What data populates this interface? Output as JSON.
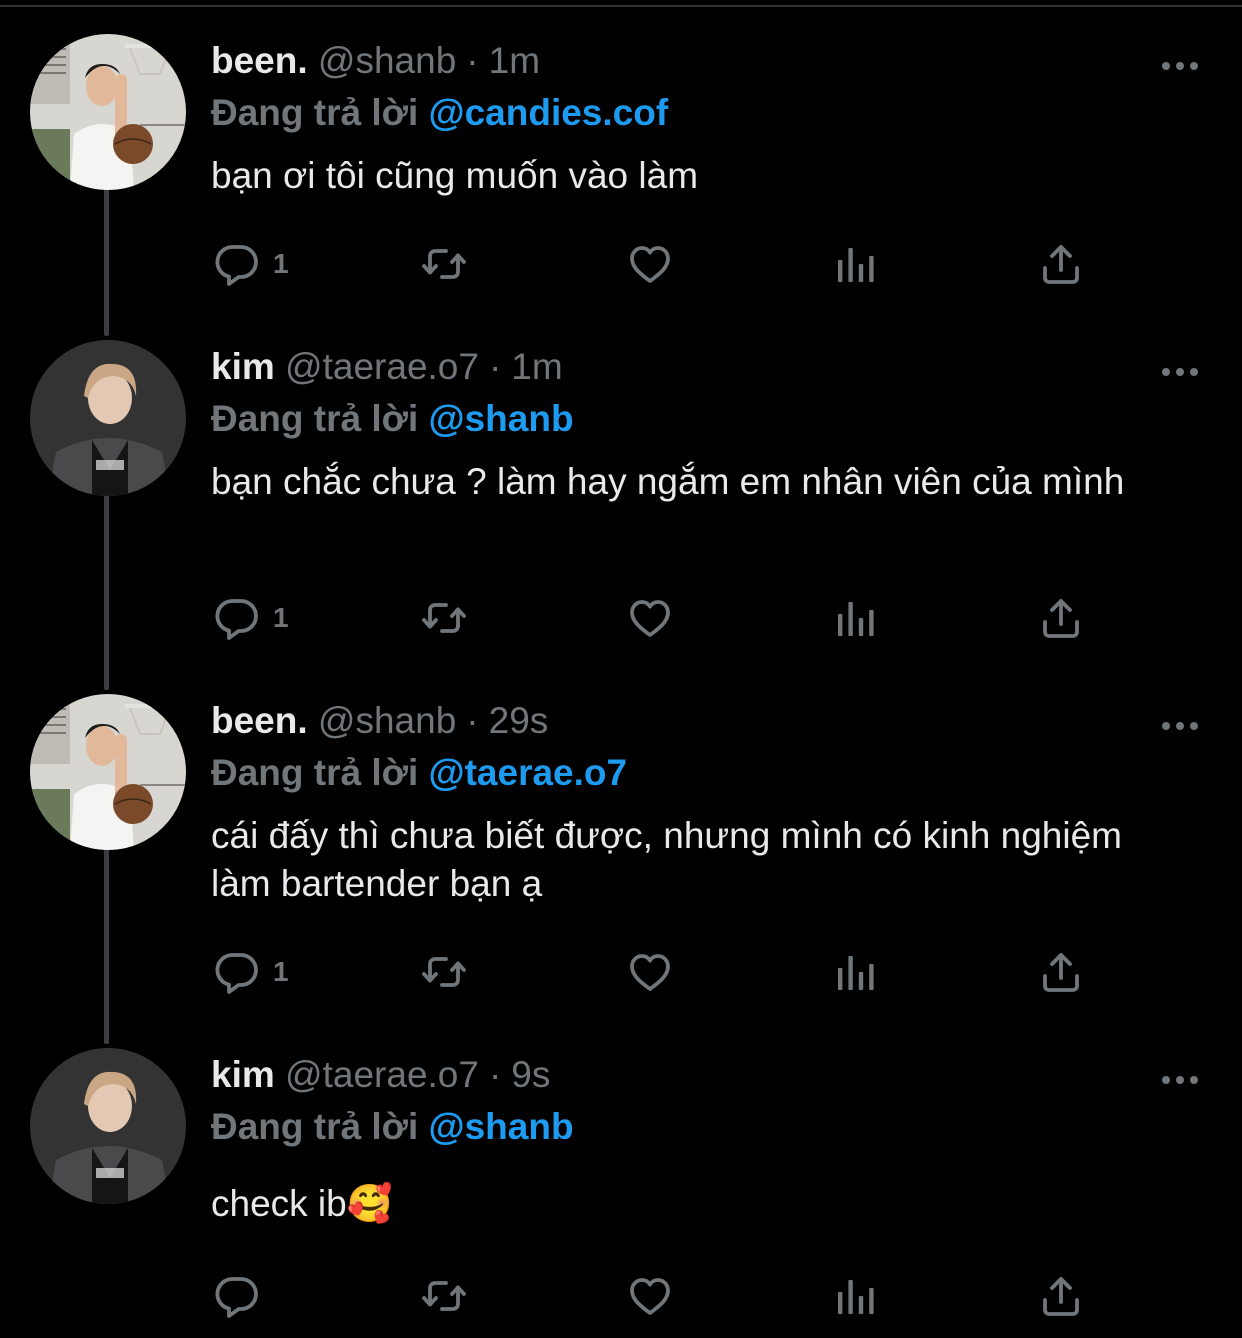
{
  "colors": {
    "background": "#000000",
    "text": "#e7e9ea",
    "muted": "#71767b",
    "mention": "#1d9bf0",
    "thread_line": "#3a3e42"
  },
  "icons": {
    "reply": "reply-icon",
    "retweet": "retweet-icon",
    "like": "heart-icon",
    "views": "analytics-icon",
    "share": "share-icon",
    "more": "more-icon"
  },
  "tweets": [
    {
      "name": "been.",
      "handle": "@shanb",
      "separator": "·",
      "time": "1m",
      "reply_prefix": "Đang trả lời",
      "reply_to": "@candies.cof",
      "text": "bạn ơi tôi cũng muốn vào làm",
      "reply_count": "1"
    },
    {
      "name": "kim",
      "handle": "@taerae.o7",
      "separator": "·",
      "time": "1m",
      "reply_prefix": "Đang trả lời",
      "reply_to": "@shanb",
      "text": "bạn chắc chưa ? làm hay ngắm em nhân viên của mình",
      "reply_count": "1"
    },
    {
      "name": "been.",
      "handle": "@shanb",
      "separator": "·",
      "time": "29s",
      "reply_prefix": "Đang trả lời",
      "reply_to": "@taerae.o7",
      "text": "cái đấy thì chưa biết được, nhưng mình có kinh nghiệm làm bartender bạn ạ",
      "reply_count": "1"
    },
    {
      "name": "kim",
      "handle": "@taerae.o7",
      "separator": "·",
      "time": "9s",
      "reply_prefix": "Đang trả lời",
      "reply_to": "@shanb",
      "text": "check ib🥰",
      "reply_count": ""
    }
  ]
}
